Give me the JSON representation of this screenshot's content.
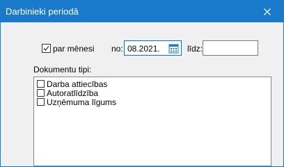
{
  "window": {
    "title": "Darbinieki periodā"
  },
  "period": {
    "per_month_label": "par mēnesi",
    "per_month_checked": true,
    "from_label": "no:",
    "from_value": "08.2021.",
    "to_label": "līdz:",
    "to_value": ""
  },
  "doc_types": {
    "label": "Dokumentu tipi:",
    "items": [
      {
        "label": "Darba attiecības",
        "checked": false
      },
      {
        "label": "Autoratlīdzība",
        "checked": false
      },
      {
        "label": "Uzņēmuma līgums",
        "checked": false
      }
    ]
  },
  "colors": {
    "titlebar": "#1979ca",
    "focus_border": "#0078d7"
  },
  "icons": {
    "close": "close-icon",
    "calendar": "calendar-icon",
    "check": "checkmark-icon"
  }
}
